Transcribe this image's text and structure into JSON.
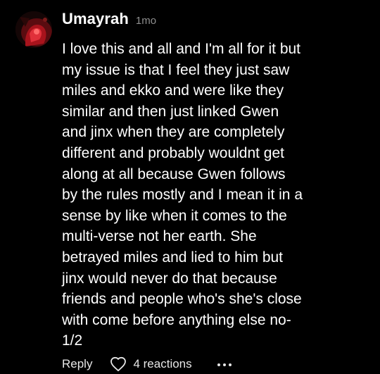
{
  "comment": {
    "username": "Umayrah",
    "timestamp": "1mo",
    "body_lines": [
      "I love this and all and I'm all for it but",
      "my issue is that I feel they just saw",
      "miles and ekko and were like they",
      "similar and then just linked Gwen",
      "and jinx when they are completely",
      "different and probably wouldnt get",
      "along at all because Gwen follows",
      "by the rules mostly and I mean it in a",
      "sense by like when it comes to the",
      "multi-verse not her earth. She",
      "betrayed miles and lied to him but",
      "jinx would never do that because",
      "friends and people who's she's close",
      "with come before anything else no-",
      "1/2"
    ]
  },
  "actions": {
    "reply_label": "Reply",
    "reactions_label": "4 reactions",
    "reaction_icon": "heart-outline-icon",
    "more_icon": "more-dots-icon"
  },
  "colors": {
    "background": "#000000",
    "text": "#ffffff",
    "muted": "#8e8e8e",
    "avatar_accent": "#c8102e"
  }
}
